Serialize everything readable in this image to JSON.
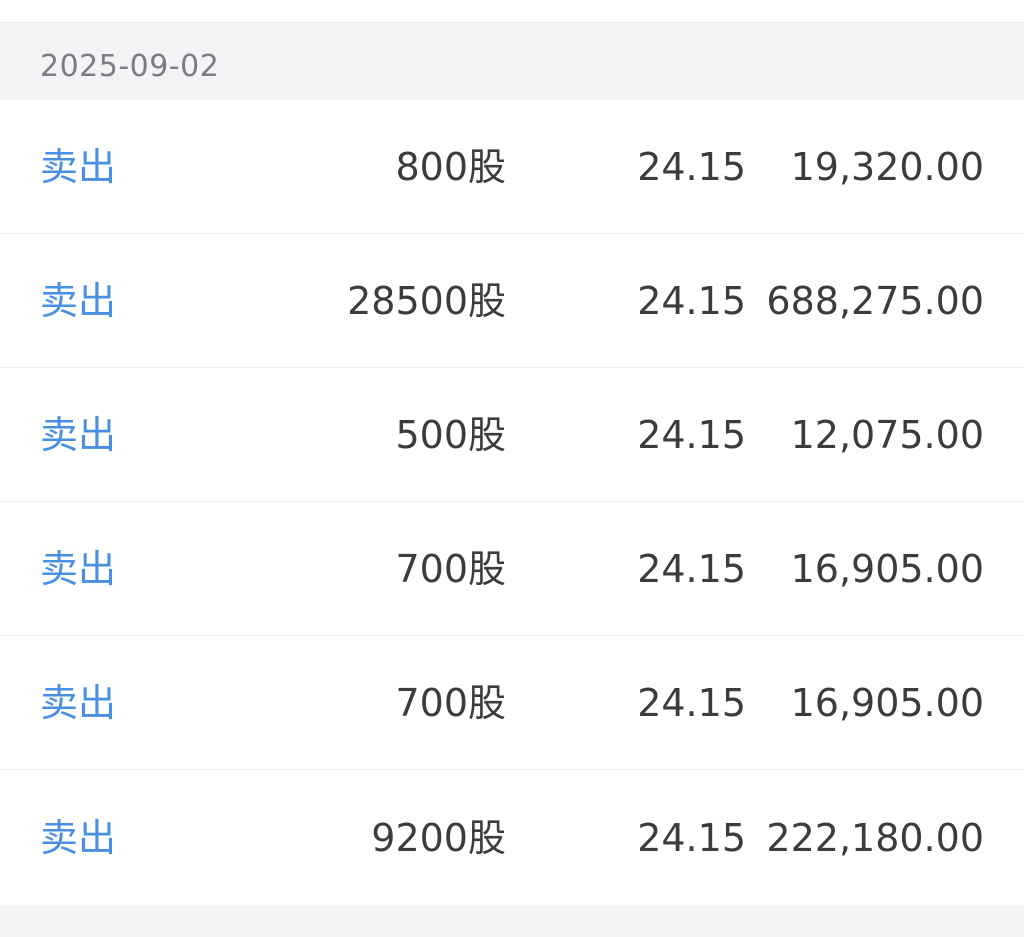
{
  "date_group": {
    "date": "2025-09-02"
  },
  "trades": [
    {
      "type": "卖出",
      "quantity": "800股",
      "price": "24.15",
      "amount": "19,320.00"
    },
    {
      "type": "卖出",
      "quantity": "28500股",
      "price": "24.15",
      "amount": "688,275.00"
    },
    {
      "type": "卖出",
      "quantity": "500股",
      "price": "24.15",
      "amount": "12,075.00"
    },
    {
      "type": "卖出",
      "quantity": "700股",
      "price": "24.15",
      "amount": "16,905.00"
    },
    {
      "type": "卖出",
      "quantity": "700股",
      "price": "24.15",
      "amount": "16,905.00"
    },
    {
      "type": "卖出",
      "quantity": "9200股",
      "price": "24.15",
      "amount": "222,180.00"
    }
  ],
  "colors": {
    "sell": "#4a90e2",
    "text": "#3a3c40",
    "date": "#7a7d83",
    "background": "#f3f4f6"
  }
}
